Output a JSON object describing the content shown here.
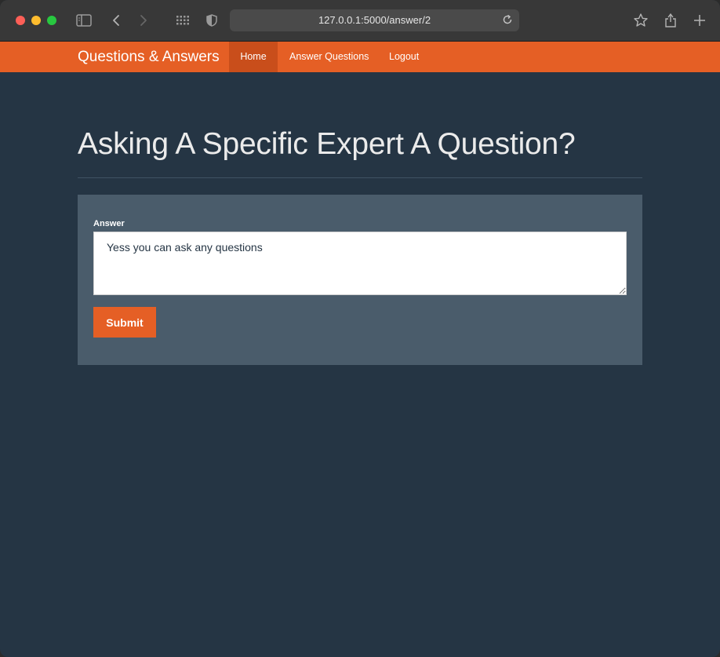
{
  "browser": {
    "url": "127.0.0.1:5000/answer/2",
    "icons": [
      "sidebar-icon",
      "back-icon",
      "forward-icon",
      "tab-grid-icon",
      "shield-icon",
      "reload-icon",
      "star-icon",
      "share-icon",
      "new-tab-icon"
    ]
  },
  "navbar": {
    "brand": "Questions & Answers",
    "items": [
      {
        "label": "Home",
        "active": true
      },
      {
        "label": "Answer Questions",
        "active": false
      },
      {
        "label": "Logout",
        "active": false
      }
    ],
    "color": "#e55f25",
    "active_color": "#c94e1b"
  },
  "page": {
    "title": "Asking A Specific Expert A Question?",
    "background": "#253544"
  },
  "form": {
    "answer_label": "Answer",
    "answer_value": "Yess you can ask any questions",
    "submit_label": "Submit",
    "panel_color": "#4a5c6b"
  }
}
